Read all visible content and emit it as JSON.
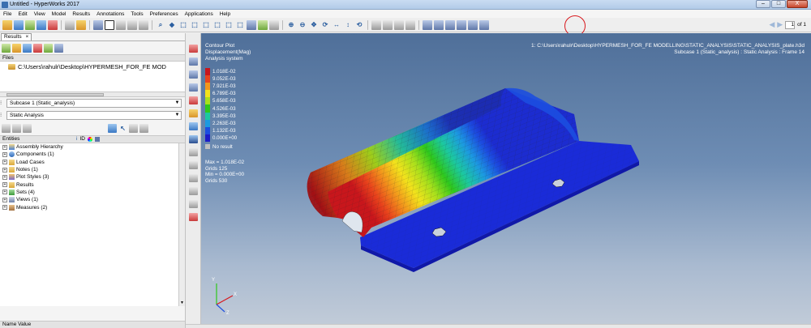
{
  "window": {
    "title": "Untitled - HyperWorks 2017",
    "buttons": [
      "–",
      "□",
      "X"
    ]
  },
  "menu": [
    "File",
    "Edit",
    "View",
    "Model",
    "Results",
    "Annotations",
    "Tools",
    "Preferences",
    "Applications",
    "Help"
  ],
  "pager": {
    "page": "1",
    "of": "of 1"
  },
  "left_panel": {
    "tab": "Results",
    "tab_close": "×",
    "files_header": "Files",
    "file_item": "C:\\Users\\rahulr\\Desktop\\HYPERMESH_FOR_FE MOD",
    "subcase": "Subcase 1 (Static_analysis)",
    "analysis": "Static Analysis",
    "entities_header": "Entities",
    "id_col": "ID",
    "tree": [
      {
        "label": "Assembly Hierarchy",
        "icon": "assembly-icon"
      },
      {
        "label": "Components (1)",
        "icon": "components-icon"
      },
      {
        "label": "Load Cases",
        "icon": "folder-icon"
      },
      {
        "label": "Notes (1)",
        "icon": "folder-icon"
      },
      {
        "label": "Plot Styles (3)",
        "icon": "plot-styles-icon"
      },
      {
        "label": "Results",
        "icon": "folder-icon"
      },
      {
        "label": "Sets (4)",
        "icon": "sets-icon"
      },
      {
        "label": "Views (1)",
        "icon": "views-icon"
      },
      {
        "label": "Measures (2)",
        "icon": "measures-icon"
      }
    ],
    "name_value_header": "Name Value"
  },
  "viewport": {
    "plot_title": "Contour Plot",
    "plot_quantity": "Displacement(Mag)",
    "plot_system": "Analysis system",
    "file_path": "1: C:\\Users\\rahulr\\Desktop\\HYPERMESH_FOR_FE MODELLING\\STATIC_ANALYSIS\\STATIC_ANALYSIS_plate.h3d",
    "subcase_info": "Subcase 1 (Static_analysis) : Static Analysis : Frame 14",
    "legend": [
      {
        "label": "1.018E-02",
        "color": "#c8161c"
      },
      {
        "label": "9.052E-03",
        "color": "#e8431c"
      },
      {
        "label": "7.921E-03",
        "color": "#f2961c"
      },
      {
        "label": "6.789E-03",
        "color": "#f2e21c"
      },
      {
        "label": "5.658E-03",
        "color": "#a8e01c"
      },
      {
        "label": "4.526E-03",
        "color": "#2ec81c"
      },
      {
        "label": "3.395E-03",
        "color": "#1cc8a0"
      },
      {
        "label": "2.263E-03",
        "color": "#1c9ae0"
      },
      {
        "label": "1.132E-03",
        "color": "#1c4ee0"
      },
      {
        "label": "0.000E+00",
        "color": "#1c1cc8"
      }
    ],
    "no_result_label": "No result",
    "no_result_color": "#c0c0c0",
    "stats": [
      "Max = 1.018E-02",
      "Grids 125",
      "Min = 0.000E+00",
      "Grids 530"
    ],
    "axes": {
      "y": "Y",
      "x": "X",
      "z": "Z"
    }
  },
  "colors": {
    "annotation_circle": "#d8171c"
  }
}
